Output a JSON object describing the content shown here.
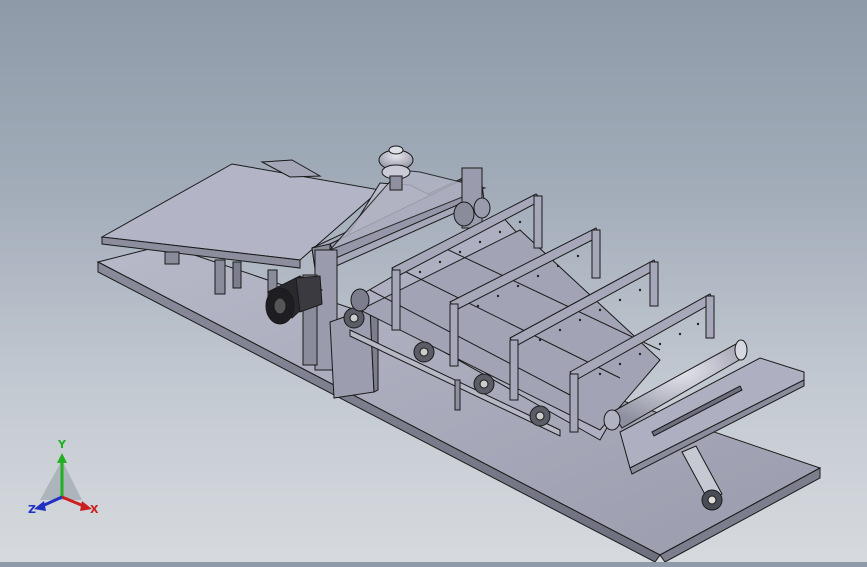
{
  "viewport": {
    "background_top": "#8e9aa8",
    "background_bottom": "#d6dade",
    "part_color": "#a9abbd",
    "edge_color": "#1a1a1a"
  },
  "triad": {
    "x_label": "X",
    "y_label": "Y",
    "z_label": "Z",
    "x_color": "#cc2020",
    "y_color": "#20b020",
    "z_color": "#2030c0"
  }
}
